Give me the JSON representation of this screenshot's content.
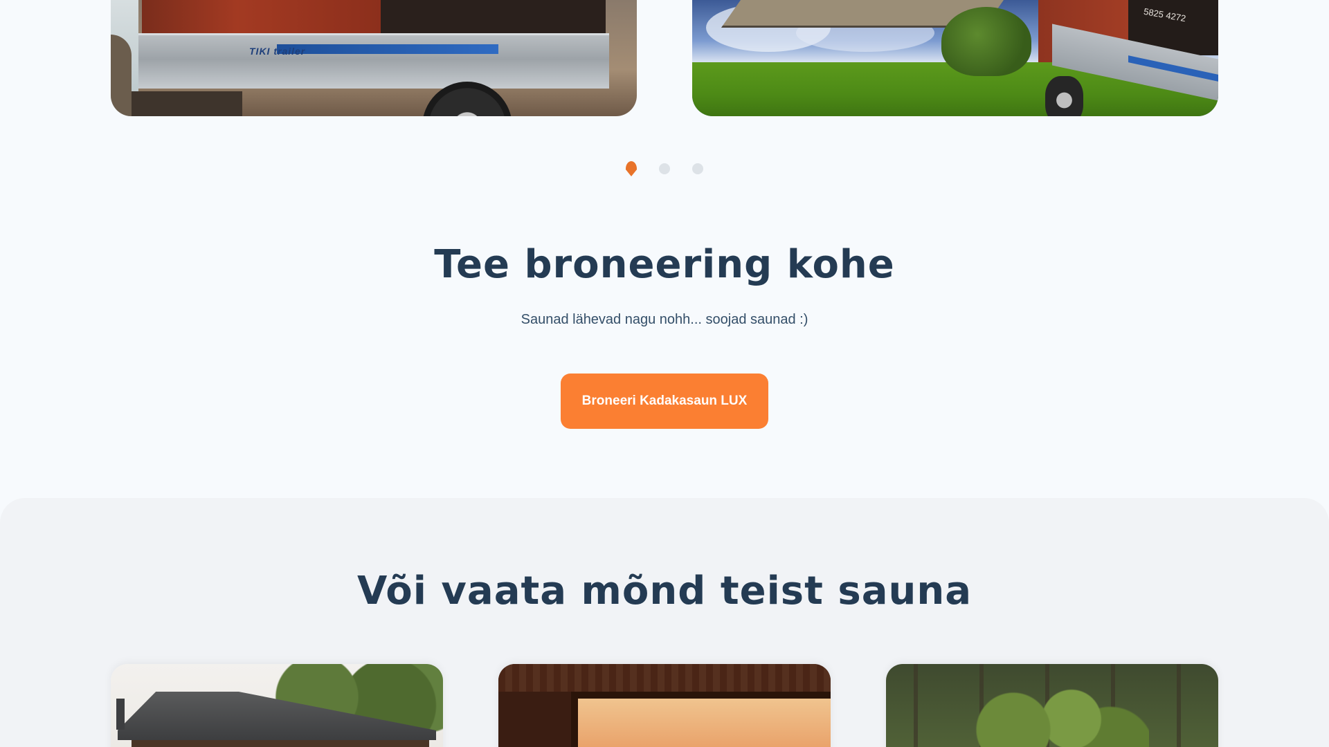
{
  "gallery": {
    "slides": [
      {
        "alt": "Kadakasaun LUX trailer sauna",
        "brand_text": "TIKI trailer"
      },
      {
        "alt": "Kadakasaun LUX trailer sauna by the lake",
        "phone_text": "5825 4272"
      }
    ],
    "active_slide": 1,
    "slide_count": 3
  },
  "booking": {
    "title": "Tee broneering kohe",
    "subtitle": "Saunad lähevad nagu nohh... soojad saunad :)",
    "cta_label": "Broneeri Kadakasaun LUX"
  },
  "others": {
    "title": "Või vaata mõnd teist sauna"
  },
  "colors": {
    "accent": "#fb7f32",
    "heading": "#243b53",
    "background": "#f7fafd",
    "section_background": "#f1f3f6",
    "dot_inactive": "#dde2e7"
  }
}
